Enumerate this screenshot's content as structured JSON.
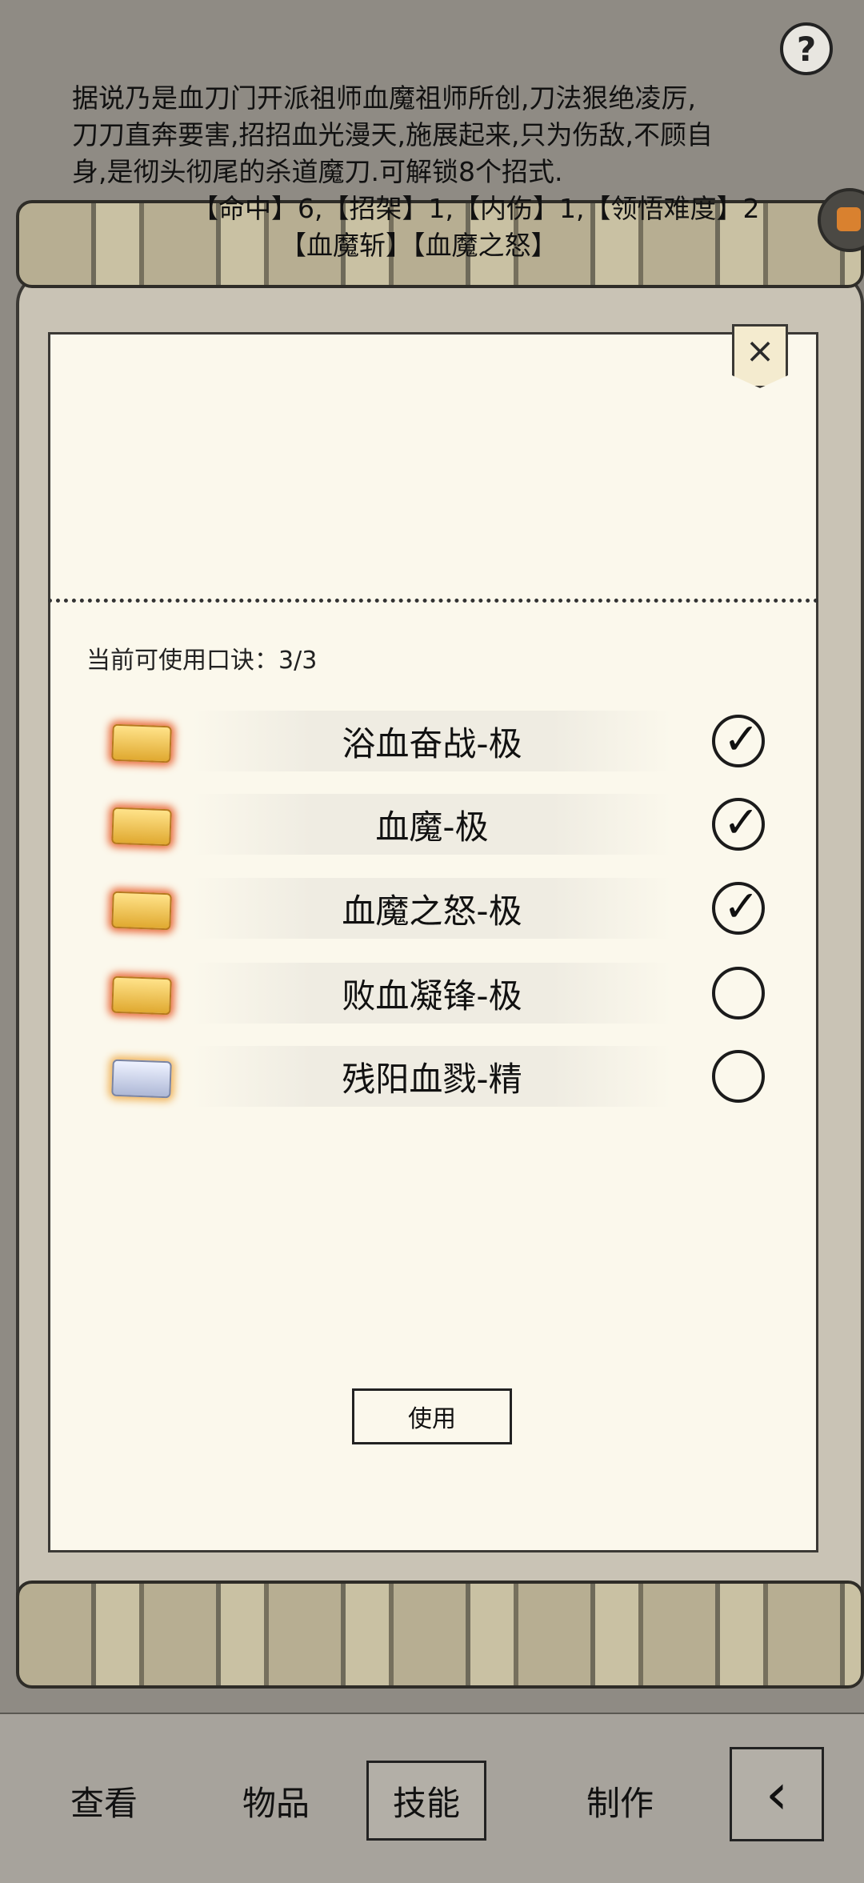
{
  "description": {
    "line1": "据说乃是血刀门开派祖师血魔祖师所创,刀法狠绝凌厉,",
    "line2": "刀刀直奔要害,招招血光漫天,施展起来,只为伤敌,不顾自",
    "line3": "身,是彻头彻尾的杀道魔刀.可解锁8个招式.",
    "line4": "【命中】6,【招架】1,【内伤】1,【领悟难度】2",
    "line5": "【血魔斩】【血魔之怒】"
  },
  "help_label": "?",
  "panel": {
    "close_label": "×",
    "counter_label": "当前可使用口诀：3/3",
    "items": [
      {
        "name": "浴血奋战-极",
        "checked": true,
        "rarity": "gold"
      },
      {
        "name": "血魔-极",
        "checked": true,
        "rarity": "gold"
      },
      {
        "name": "血魔之怒-极",
        "checked": true,
        "rarity": "gold"
      },
      {
        "name": "败血凝锋-极",
        "checked": false,
        "rarity": "gold"
      },
      {
        "name": "残阳血戮-精",
        "checked": false,
        "rarity": "silver"
      }
    ],
    "use_label": "使用"
  },
  "nav": {
    "view": "查看",
    "items": "物品",
    "skills": "技能",
    "craft": "制作",
    "back_icon": "back-arrow-icon"
  }
}
